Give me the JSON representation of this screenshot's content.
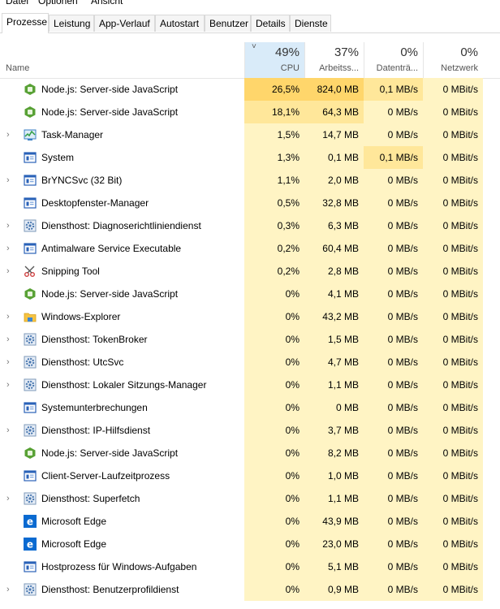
{
  "menu": [
    "Datei",
    "Optionen",
    "Ansicht"
  ],
  "tabs": [
    "Prozesse",
    "Leistung",
    "App-Verlauf",
    "Autostart",
    "Benutzer",
    "Details",
    "Dienste"
  ],
  "active_tab": "Prozesse",
  "columns": {
    "name": {
      "label": "Name"
    },
    "cpu": {
      "pct": "49%",
      "label": "CPU"
    },
    "mem": {
      "pct": "37%",
      "label": "Arbeitss..."
    },
    "disk": {
      "pct": "0%",
      "label": "Datenträ..."
    },
    "net": {
      "pct": "0%",
      "label": "Netzwerk"
    }
  },
  "sort_indicator": "˅",
  "colors": {
    "heat_low": "#fff4c4",
    "heat_mid": "#ffe79a",
    "heat_high": "#ffd66b",
    "sorted_header": "#d9ebf9",
    "edge_blue": "#0a6ad1",
    "node_green": "#58a135"
  },
  "processes": [
    {
      "name": "Node.js: Server-side JavaScript",
      "icon": "nodejs-icon",
      "expand": false,
      "cpu": "26,5%",
      "mem": "824,0 MB",
      "disk": "0,1 MB/s",
      "net": "0 MBit/s",
      "heat": {
        "cpu": "high",
        "mem": "high",
        "disk": "mid",
        "net": "low"
      }
    },
    {
      "name": "Node.js: Server-side JavaScript",
      "icon": "nodejs-icon",
      "expand": false,
      "cpu": "18,1%",
      "mem": "64,3 MB",
      "disk": "0 MB/s",
      "net": "0 MBit/s",
      "heat": {
        "cpu": "mid",
        "mem": "mid",
        "disk": "low",
        "net": "low"
      }
    },
    {
      "name": "Task-Manager",
      "icon": "task-manager-icon",
      "expand": true,
      "cpu": "1,5%",
      "mem": "14,7 MB",
      "disk": "0 MB/s",
      "net": "0 MBit/s",
      "heat": {
        "cpu": "low",
        "mem": "low",
        "disk": "low",
        "net": "low"
      }
    },
    {
      "name": "System",
      "icon": "window-app-icon",
      "expand": false,
      "cpu": "1,3%",
      "mem": "0,1 MB",
      "disk": "0,1 MB/s",
      "net": "0 MBit/s",
      "heat": {
        "cpu": "low",
        "mem": "low",
        "disk": "mid",
        "net": "low"
      }
    },
    {
      "name": "BrYNCSvc (32 Bit)",
      "icon": "window-app-icon",
      "expand": true,
      "cpu": "1,1%",
      "mem": "2,0 MB",
      "disk": "0 MB/s",
      "net": "0 MBit/s",
      "heat": {
        "cpu": "low",
        "mem": "low",
        "disk": "low",
        "net": "low"
      }
    },
    {
      "name": "Desktopfenster-Manager",
      "icon": "window-app-icon",
      "expand": false,
      "cpu": "0,5%",
      "mem": "32,8 MB",
      "disk": "0 MB/s",
      "net": "0 MBit/s",
      "heat": {
        "cpu": "low",
        "mem": "low",
        "disk": "low",
        "net": "low"
      }
    },
    {
      "name": "Diensthost: Diagnoserichtliniendienst",
      "icon": "gear-icon",
      "expand": true,
      "cpu": "0,3%",
      "mem": "6,3 MB",
      "disk": "0 MB/s",
      "net": "0 MBit/s",
      "heat": {
        "cpu": "low",
        "mem": "low",
        "disk": "low",
        "net": "low"
      }
    },
    {
      "name": "Antimalware Service Executable",
      "icon": "window-app-icon",
      "expand": true,
      "cpu": "0,2%",
      "mem": "60,4 MB",
      "disk": "0 MB/s",
      "net": "0 MBit/s",
      "heat": {
        "cpu": "low",
        "mem": "low",
        "disk": "low",
        "net": "low"
      }
    },
    {
      "name": "Snipping Tool",
      "icon": "scissors-icon",
      "expand": true,
      "cpu": "0,2%",
      "mem": "2,8 MB",
      "disk": "0 MB/s",
      "net": "0 MBit/s",
      "heat": {
        "cpu": "low",
        "mem": "low",
        "disk": "low",
        "net": "low"
      }
    },
    {
      "name": "Node.js: Server-side JavaScript",
      "icon": "nodejs-icon",
      "expand": false,
      "cpu": "0%",
      "mem": "4,1 MB",
      "disk": "0 MB/s",
      "net": "0 MBit/s",
      "heat": {
        "cpu": "low",
        "mem": "low",
        "disk": "low",
        "net": "low"
      }
    },
    {
      "name": "Windows-Explorer",
      "icon": "explorer-folder-icon",
      "expand": true,
      "cpu": "0%",
      "mem": "43,2 MB",
      "disk": "0 MB/s",
      "net": "0 MBit/s",
      "heat": {
        "cpu": "low",
        "mem": "low",
        "disk": "low",
        "net": "low"
      }
    },
    {
      "name": "Diensthost: TokenBroker",
      "icon": "gear-icon",
      "expand": true,
      "cpu": "0%",
      "mem": "1,5 MB",
      "disk": "0 MB/s",
      "net": "0 MBit/s",
      "heat": {
        "cpu": "low",
        "mem": "low",
        "disk": "low",
        "net": "low"
      }
    },
    {
      "name": "Diensthost: UtcSvc",
      "icon": "gear-icon",
      "expand": true,
      "cpu": "0%",
      "mem": "4,7 MB",
      "disk": "0 MB/s",
      "net": "0 MBit/s",
      "heat": {
        "cpu": "low",
        "mem": "low",
        "disk": "low",
        "net": "low"
      }
    },
    {
      "name": "Diensthost: Lokaler Sitzungs-Manager",
      "icon": "gear-icon",
      "expand": true,
      "cpu": "0%",
      "mem": "1,1 MB",
      "disk": "0 MB/s",
      "net": "0 MBit/s",
      "heat": {
        "cpu": "low",
        "mem": "low",
        "disk": "low",
        "net": "low"
      }
    },
    {
      "name": "Systemunterbrechungen",
      "icon": "window-app-icon",
      "expand": false,
      "cpu": "0%",
      "mem": "0 MB",
      "disk": "0 MB/s",
      "net": "0 MBit/s",
      "heat": {
        "cpu": "low",
        "mem": "low",
        "disk": "low",
        "net": "low"
      }
    },
    {
      "name": "Diensthost: IP-Hilfsdienst",
      "icon": "gear-icon",
      "expand": true,
      "cpu": "0%",
      "mem": "3,7 MB",
      "disk": "0 MB/s",
      "net": "0 MBit/s",
      "heat": {
        "cpu": "low",
        "mem": "low",
        "disk": "low",
        "net": "low"
      }
    },
    {
      "name": "Node.js: Server-side JavaScript",
      "icon": "nodejs-icon",
      "expand": false,
      "cpu": "0%",
      "mem": "8,2 MB",
      "disk": "0 MB/s",
      "net": "0 MBit/s",
      "heat": {
        "cpu": "low",
        "mem": "low",
        "disk": "low",
        "net": "low"
      }
    },
    {
      "name": "Client-Server-Laufzeitprozess",
      "icon": "window-app-icon",
      "expand": false,
      "cpu": "0%",
      "mem": "1,0 MB",
      "disk": "0 MB/s",
      "net": "0 MBit/s",
      "heat": {
        "cpu": "low",
        "mem": "low",
        "disk": "low",
        "net": "low"
      }
    },
    {
      "name": "Diensthost: Superfetch",
      "icon": "gear-icon",
      "expand": true,
      "cpu": "0%",
      "mem": "1,1 MB",
      "disk": "0 MB/s",
      "net": "0 MBit/s",
      "heat": {
        "cpu": "low",
        "mem": "low",
        "disk": "low",
        "net": "low"
      }
    },
    {
      "name": "Microsoft Edge",
      "icon": "edge-icon",
      "expand": false,
      "cpu": "0%",
      "mem": "43,9 MB",
      "disk": "0 MB/s",
      "net": "0 MBit/s",
      "heat": {
        "cpu": "low",
        "mem": "low",
        "disk": "low",
        "net": "low"
      }
    },
    {
      "name": "Microsoft Edge",
      "icon": "edge-icon",
      "expand": false,
      "cpu": "0%",
      "mem": "23,0 MB",
      "disk": "0 MB/s",
      "net": "0 MBit/s",
      "heat": {
        "cpu": "low",
        "mem": "low",
        "disk": "low",
        "net": "low"
      }
    },
    {
      "name": "Hostprozess für Windows-Aufgaben",
      "icon": "window-app-icon",
      "expand": false,
      "cpu": "0%",
      "mem": "5,1 MB",
      "disk": "0 MB/s",
      "net": "0 MBit/s",
      "heat": {
        "cpu": "low",
        "mem": "low",
        "disk": "low",
        "net": "low"
      }
    },
    {
      "name": "Diensthost: Benutzerprofildienst",
      "icon": "gear-icon",
      "expand": true,
      "cpu": "0%",
      "mem": "0,9 MB",
      "disk": "0 MB/s",
      "net": "0 MBit/s",
      "heat": {
        "cpu": "low",
        "mem": "low",
        "disk": "low",
        "net": "low"
      }
    }
  ]
}
